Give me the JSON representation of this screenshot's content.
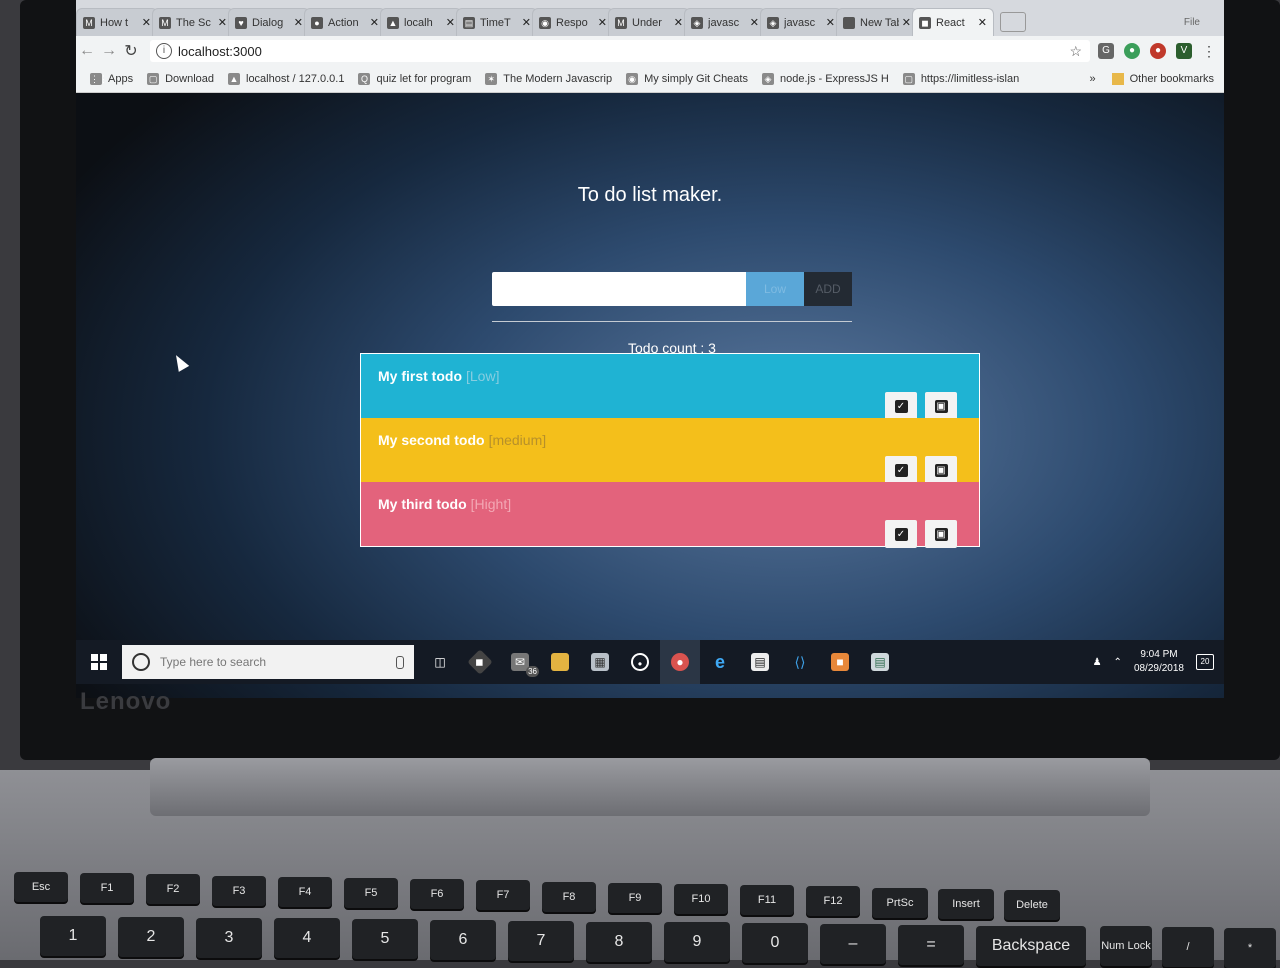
{
  "browser": {
    "tabs": [
      {
        "icon": "M",
        "label": "How t"
      },
      {
        "icon": "M",
        "label": "The Sc"
      },
      {
        "icon": "♥",
        "label": "Dialog"
      },
      {
        "icon": "●",
        "label": "Action"
      },
      {
        "icon": "▲",
        "label": "localh"
      },
      {
        "icon": "▤",
        "label": "TimeT"
      },
      {
        "icon": "◉",
        "label": "Respo"
      },
      {
        "icon": "M",
        "label": "Under"
      },
      {
        "icon": "◈",
        "label": "javasc"
      },
      {
        "icon": "◈",
        "label": "javasc"
      },
      {
        "icon": "",
        "label": "New Tab"
      },
      {
        "icon": "◼",
        "label": "React"
      }
    ],
    "active_tab_index": 11,
    "profile_label": "File",
    "url": "localhost:3000",
    "bookmarks": [
      {
        "icon": "⋮⋮",
        "label": "Apps"
      },
      {
        "icon": "▢",
        "label": "Download"
      },
      {
        "icon": "▲",
        "label": "localhost / 127.0.0.1"
      },
      {
        "icon": "Q",
        "label": "quiz let for program"
      },
      {
        "icon": "✶",
        "label": "The Modern Javascrip"
      },
      {
        "icon": "◉",
        "label": "My simply Git Cheats"
      },
      {
        "icon": "◈",
        "label": "node.js - ExpressJS H"
      },
      {
        "icon": "▢",
        "label": "https://limitless-islan"
      }
    ],
    "overflow_label": "»",
    "other_bookmarks": "Other bookmarks"
  },
  "app": {
    "title": "To do list maker.",
    "input_placeholder": "",
    "priority_label": "Low",
    "add_label": "ADD",
    "count_label": "Todo count : 3",
    "todos": [
      {
        "name": "My first todo",
        "level": "[Low]",
        "color": "#1fb3d3",
        "level_color": "#87cde0"
      },
      {
        "name": "My second todo",
        "level": "[medium]",
        "color": "#f4bf1b",
        "level_color": "#b7902a"
      },
      {
        "name": "My third todo",
        "level": "[Hight]",
        "color": "#e3637c",
        "level_color": "#f3a7b4"
      }
    ]
  },
  "taskbar": {
    "search_placeholder": "Type here to search",
    "mail_badge": "36",
    "time": "9:04 PM",
    "date": "08/29/2018",
    "notifications": "20"
  },
  "keyboard": {
    "fn_row": [
      "Esc",
      "F1",
      "F2",
      "F3",
      "F4",
      "F5",
      "F6",
      "F7",
      "F8",
      "F9",
      "F10",
      "F11",
      "F12",
      "PrtSc",
      "Insert",
      "Delete"
    ],
    "num_row": [
      "1",
      "2",
      "3",
      "4",
      "5",
      "6",
      "7",
      "8",
      "9",
      "0",
      "–",
      "=",
      "Backspace",
      "Num Lock",
      "/",
      "*"
    ],
    "brand": "Lenovo"
  }
}
